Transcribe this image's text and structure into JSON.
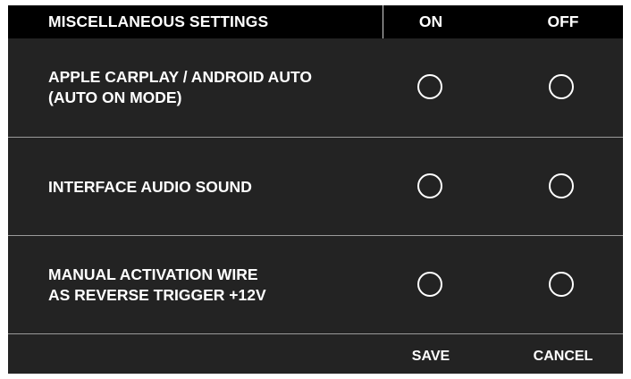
{
  "header": {
    "title": "MISCELLANEOUS SETTINGS",
    "on_label": "ON",
    "off_label": "OFF"
  },
  "settings": [
    {
      "lines": [
        "APPLE CARPLAY / ANDROID AUTO",
        "(AUTO ON MODE)"
      ],
      "on_selected": false,
      "off_selected": false
    },
    {
      "lines": [
        "INTERFACE AUDIO SOUND"
      ],
      "on_selected": false,
      "off_selected": false
    },
    {
      "lines": [
        "MANUAL ACTIVATION WIRE",
        "AS REVERSE TRIGGER +12V"
      ],
      "on_selected": false,
      "off_selected": false
    }
  ],
  "footer": {
    "save_label": "SAVE",
    "cancel_label": "CANCEL"
  },
  "colors": {
    "background": "#232323",
    "header_background": "#000000",
    "text": "#ffffff",
    "separator": "#9a9a9a"
  }
}
